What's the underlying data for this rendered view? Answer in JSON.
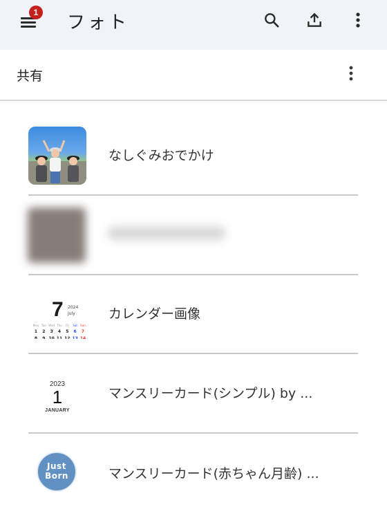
{
  "appbar": {
    "title": "フォト",
    "menu_icon": "hamburger-menu-icon",
    "notification_badge": "1",
    "actions": [
      {
        "name": "search",
        "icon": "search-icon"
      },
      {
        "name": "upload",
        "icon": "upload-icon"
      },
      {
        "name": "more",
        "icon": "more-vert-icon"
      }
    ],
    "background": "#f0f3f8",
    "badge_color": "#c5221f"
  },
  "section": {
    "title": "共有",
    "more_icon": "more-vert-icon"
  },
  "albums": [
    {
      "label": "なしぐみおでかけ",
      "thumb": "photo-children"
    },
    {
      "label": "",
      "thumb": "blurred",
      "blurred": true
    },
    {
      "label": "カレンダー画像",
      "thumb": "calendar",
      "calendar": {
        "day": "7",
        "year": "2024",
        "month": "July",
        "weekdays": [
          "Mon",
          "Tue",
          "Wed",
          "Thu",
          "Fri",
          "Sat",
          "Sun"
        ],
        "week1": [
          "1",
          "2",
          "3",
          "4",
          "5",
          "6",
          "7"
        ],
        "week2": [
          "8",
          "9",
          "10",
          "11",
          "12",
          "13",
          "14"
        ]
      }
    },
    {
      "label": "マンスリーカード(シンプル) by ...",
      "thumb": "monthly-card",
      "card": {
        "year": "2023",
        "day": "1",
        "month": "JANUARY"
      }
    },
    {
      "label": "マンスリーカード(赤ちゃん月齢) ...",
      "thumb": "just-born",
      "badge": {
        "line1": "Just",
        "line2": "Born",
        "color": "#6190c3"
      }
    }
  ]
}
